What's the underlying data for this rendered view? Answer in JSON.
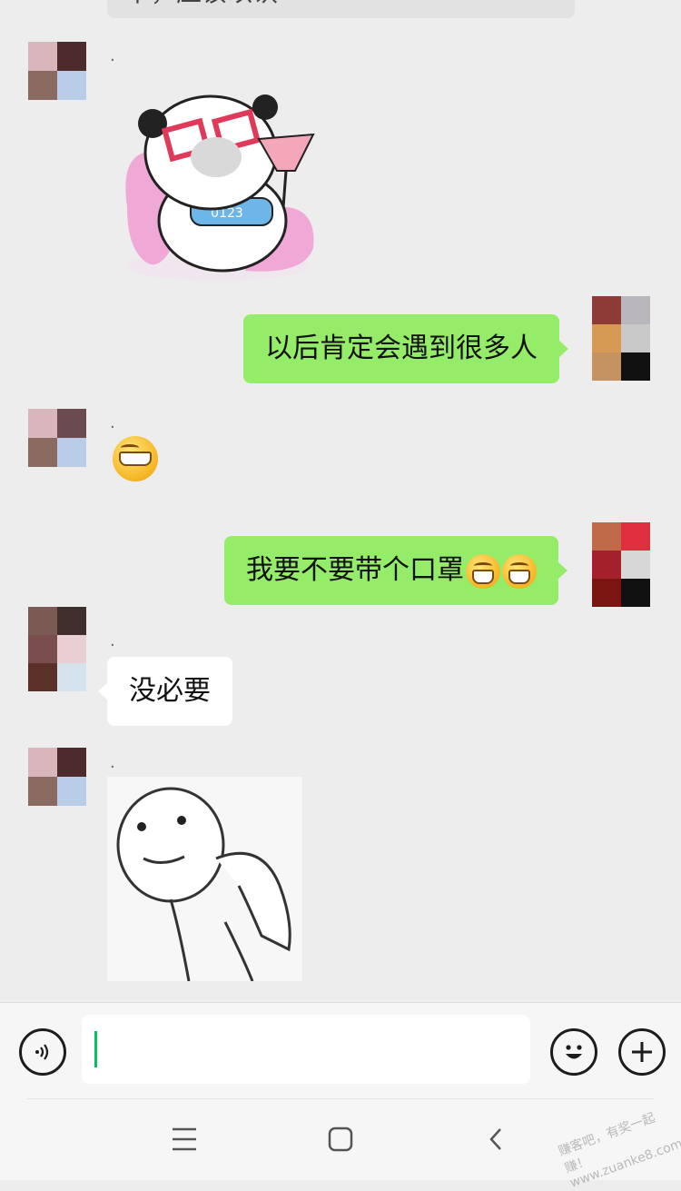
{
  "messages": {
    "top_partial_text": "下，应该以认",
    "sender_mark": ".",
    "m1_sticker": "panda-sunglasses-sticker",
    "m2_text": "以后肯定会遇到很多人",
    "m3_emoji": "grin-emoji",
    "m4_text": "我要不要带个口罩",
    "m5_text": "没必要",
    "m6_sticker": "meme-face-sticker"
  },
  "input": {
    "value": "",
    "voice_icon": "voice-icon",
    "emoji_icon": "emoji-icon",
    "add_icon": "add-icon"
  },
  "nav": {
    "menu_icon": "menu-icon",
    "home_icon": "home-icon",
    "back_icon": "back-icon"
  },
  "watermark": {
    "line1": "赚客吧，有奖一起赚！",
    "line2": "www.zuanke8.com"
  },
  "colors": {
    "background": "#ededed",
    "self_bubble": "#95ec69",
    "other_bubble": "#ffffff",
    "caret": "#07c160"
  }
}
